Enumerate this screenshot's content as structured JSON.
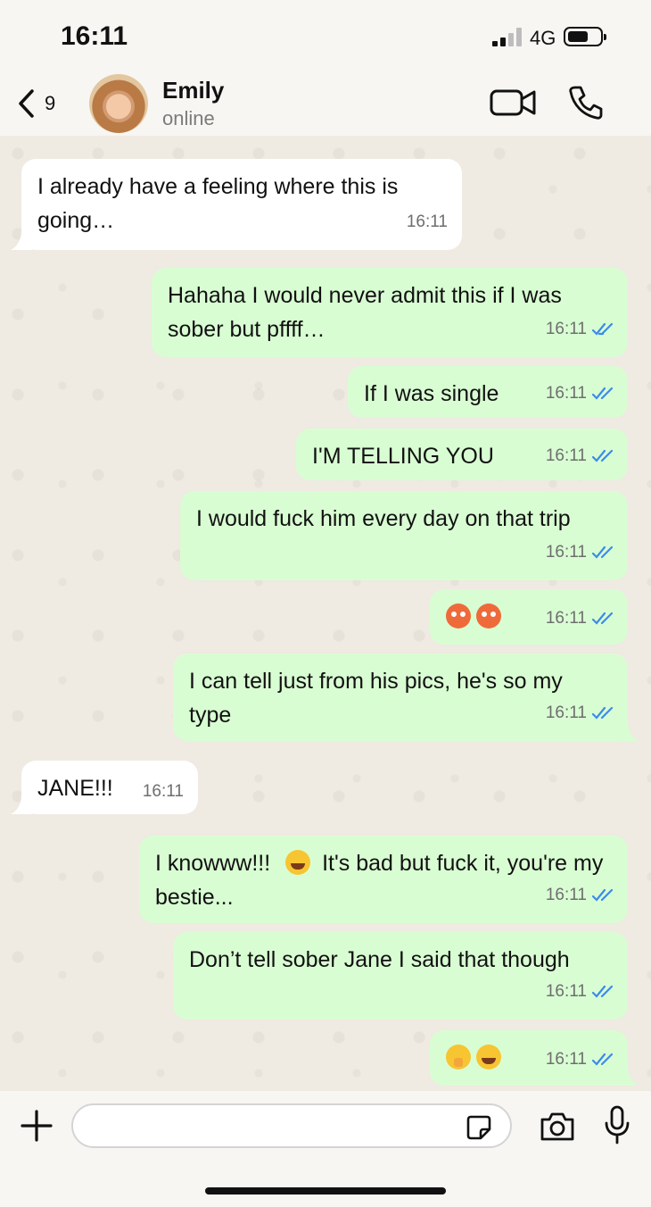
{
  "status_bar": {
    "time": "16:11",
    "network": "4G"
  },
  "header": {
    "back_count": "9",
    "contact_name": "Emily",
    "contact_status": "online"
  },
  "messages": [
    {
      "dir": "in",
      "text": "I already have a feeling where this is going…",
      "time": "16:11"
    },
    {
      "dir": "out",
      "text": "Hahaha I would never admit this if I was sober but pffff…",
      "time": "16:11"
    },
    {
      "dir": "out",
      "text": "If I was single",
      "time": "16:11"
    },
    {
      "dir": "out",
      "text": "I'M TELLING YOU",
      "time": "16:11"
    },
    {
      "dir": "out",
      "text": "I would fuck him every day on that trip",
      "time": "16:11"
    },
    {
      "dir": "out",
      "emojis": [
        "hot-face-emoji",
        "hot-face-emoji"
      ],
      "time": "16:11"
    },
    {
      "dir": "out",
      "text": "I can tell just from his pics, he's so my type",
      "time": "16:11"
    },
    {
      "dir": "in",
      "text": "JANE!!!",
      "time": "16:11"
    },
    {
      "dir": "out",
      "text_a": "I knowww!!!",
      "emoji": "laughing-emoji",
      "text_b": "It's bad but fuck it, you're my bestie...",
      "time": "16:11"
    },
    {
      "dir": "out",
      "text": "Don’t tell sober Jane I said that though",
      "time": "16:11"
    },
    {
      "dir": "out",
      "emojis": [
        "shushing-face-emoji",
        "laughing-emoji"
      ],
      "time": "16:11"
    }
  ],
  "colors": {
    "incoming": "#ffffff",
    "outgoing": "#d9fdd3",
    "read_ticks": "#3b8bea",
    "chat_bg": "#efeae2"
  },
  "icons": [
    "back-chevron-icon",
    "video-call-icon",
    "phone-icon",
    "plus-icon",
    "sticker-icon",
    "camera-icon",
    "microphone-icon"
  ]
}
